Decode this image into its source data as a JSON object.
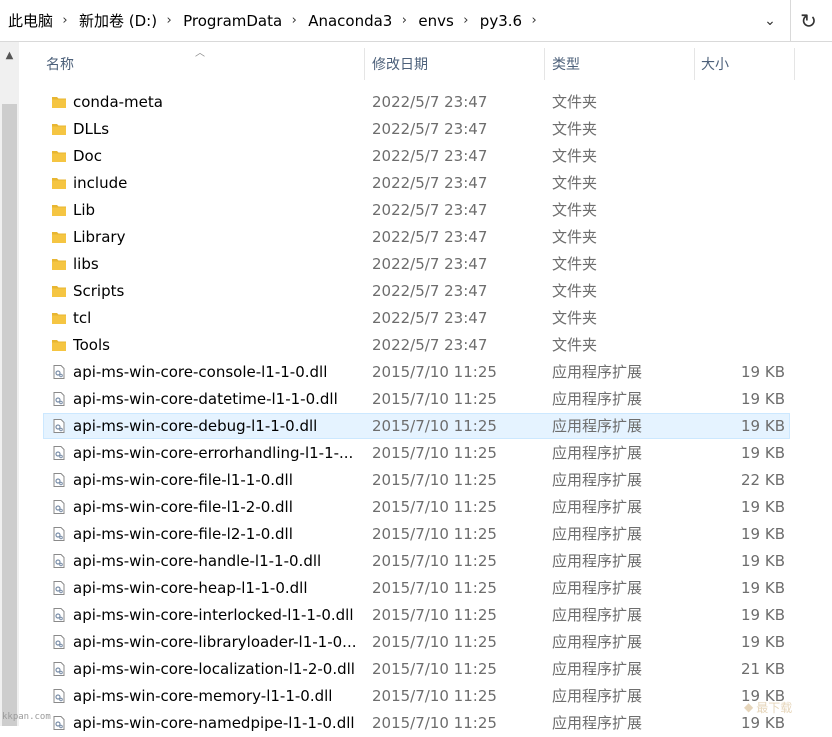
{
  "address": {
    "crumbs": [
      "此电脑",
      "新加卷 (D:)",
      "ProgramData",
      "Anaconda3",
      "envs",
      "py3.6"
    ],
    "separator": "›",
    "dropdown_glyph": "⌄",
    "refresh_glyph": "↻"
  },
  "columns": {
    "name": "名称",
    "date": "修改日期",
    "type": "类型",
    "size": "大小"
  },
  "files": [
    {
      "name": "conda-meta",
      "date": "2022/5/7 23:47",
      "type": "文件夹",
      "size": "",
      "icon": "folder-icon"
    },
    {
      "name": "DLLs",
      "date": "2022/5/7 23:47",
      "type": "文件夹",
      "size": "",
      "icon": "folder-icon"
    },
    {
      "name": "Doc",
      "date": "2022/5/7 23:47",
      "type": "文件夹",
      "size": "",
      "icon": "folder-icon"
    },
    {
      "name": "include",
      "date": "2022/5/7 23:47",
      "type": "文件夹",
      "size": "",
      "icon": "folder-icon"
    },
    {
      "name": "Lib",
      "date": "2022/5/7 23:47",
      "type": "文件夹",
      "size": "",
      "icon": "folder-icon"
    },
    {
      "name": "Library",
      "date": "2022/5/7 23:47",
      "type": "文件夹",
      "size": "",
      "icon": "folder-icon"
    },
    {
      "name": "libs",
      "date": "2022/5/7 23:47",
      "type": "文件夹",
      "size": "",
      "icon": "folder-icon"
    },
    {
      "name": "Scripts",
      "date": "2022/5/7 23:47",
      "type": "文件夹",
      "size": "",
      "icon": "folder-icon"
    },
    {
      "name": "tcl",
      "date": "2022/5/7 23:47",
      "type": "文件夹",
      "size": "",
      "icon": "folder-icon"
    },
    {
      "name": "Tools",
      "date": "2022/5/7 23:47",
      "type": "文件夹",
      "size": "",
      "icon": "folder-icon"
    },
    {
      "name": "api-ms-win-core-console-l1-1-0.dll",
      "date": "2015/7/10 11:25",
      "type": "应用程序扩展",
      "size": "19 KB",
      "icon": "dll-icon"
    },
    {
      "name": "api-ms-win-core-datetime-l1-1-0.dll",
      "date": "2015/7/10 11:25",
      "type": "应用程序扩展",
      "size": "19 KB",
      "icon": "dll-icon"
    },
    {
      "name": "api-ms-win-core-debug-l1-1-0.dll",
      "date": "2015/7/10 11:25",
      "type": "应用程序扩展",
      "size": "19 KB",
      "icon": "dll-icon",
      "selected": true
    },
    {
      "name": "api-ms-win-core-errorhandling-l1-1-...",
      "date": "2015/7/10 11:25",
      "type": "应用程序扩展",
      "size": "19 KB",
      "icon": "dll-icon"
    },
    {
      "name": "api-ms-win-core-file-l1-1-0.dll",
      "date": "2015/7/10 11:25",
      "type": "应用程序扩展",
      "size": "22 KB",
      "icon": "dll-icon"
    },
    {
      "name": "api-ms-win-core-file-l1-2-0.dll",
      "date": "2015/7/10 11:25",
      "type": "应用程序扩展",
      "size": "19 KB",
      "icon": "dll-icon"
    },
    {
      "name": "api-ms-win-core-file-l2-1-0.dll",
      "date": "2015/7/10 11:25",
      "type": "应用程序扩展",
      "size": "19 KB",
      "icon": "dll-icon"
    },
    {
      "name": "api-ms-win-core-handle-l1-1-0.dll",
      "date": "2015/7/10 11:25",
      "type": "应用程序扩展",
      "size": "19 KB",
      "icon": "dll-icon"
    },
    {
      "name": "api-ms-win-core-heap-l1-1-0.dll",
      "date": "2015/7/10 11:25",
      "type": "应用程序扩展",
      "size": "19 KB",
      "icon": "dll-icon"
    },
    {
      "name": "api-ms-win-core-interlocked-l1-1-0.dll",
      "date": "2015/7/10 11:25",
      "type": "应用程序扩展",
      "size": "19 KB",
      "icon": "dll-icon"
    },
    {
      "name": "api-ms-win-core-libraryloader-l1-1-0...",
      "date": "2015/7/10 11:25",
      "type": "应用程序扩展",
      "size": "19 KB",
      "icon": "dll-icon"
    },
    {
      "name": "api-ms-win-core-localization-l1-2-0.dll",
      "date": "2015/7/10 11:25",
      "type": "应用程序扩展",
      "size": "21 KB",
      "icon": "dll-icon"
    },
    {
      "name": "api-ms-win-core-memory-l1-1-0.dll",
      "date": "2015/7/10 11:25",
      "type": "应用程序扩展",
      "size": "19 KB",
      "icon": "dll-icon"
    },
    {
      "name": "api-ms-win-core-namedpipe-l1-1-0.dll",
      "date": "2015/7/10 11:25",
      "type": "应用程序扩展",
      "size": "19 KB",
      "icon": "dll-icon"
    }
  ],
  "watermark": {
    "left": "kkpan.com",
    "right": "最下载"
  },
  "colors": {
    "folder": "#f5c542",
    "header_text": "#4c607a",
    "secondary_text": "#6d6d6d",
    "selection_bg": "#e5f3ff",
    "selection_border": "#cce8ff"
  }
}
